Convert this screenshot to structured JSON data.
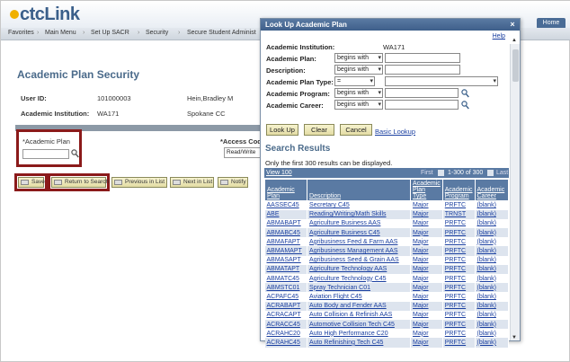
{
  "app": {
    "logo_text": "ctcLink",
    "home_label": "Home"
  },
  "nav": {
    "items": [
      "Favorites",
      "Main Menu",
      "Set Up SACR",
      "Security",
      "Secure Student Administ"
    ],
    "separator": "›"
  },
  "page": {
    "title": "Academic Plan Security",
    "user_id_label": "User ID:",
    "user_id_value": "101000003",
    "user_name": "Hein,Bradley M",
    "institution_label": "Academic Institution:",
    "institution_value": "WA171",
    "institution_name": "Spokane CC",
    "academic_plan_label": "*Academic Plan",
    "access_code_label": "*Access Cod",
    "access_code_value": "Read/Write"
  },
  "toolbar": {
    "save_label": "Save",
    "return_label": "Return to Search",
    "prev_label": "Previous in List",
    "next_label": "Next in List",
    "notify_label": "Notify"
  },
  "modal": {
    "title": "Look Up Academic Plan",
    "close_glyph": "×",
    "help_label": "Help",
    "institution_label": "Academic Institution:",
    "institution_value": "WA171",
    "plan_label": "Academic Plan:",
    "plan_operator": "begins with",
    "description_label": "Description:",
    "description_operator": "begins with",
    "plan_type_label": "Academic Plan Type:",
    "plan_type_operator": "=",
    "program_label": "Academic Program:",
    "program_operator": "begins with",
    "career_label": "Academic Career:",
    "career_operator": "begins with",
    "lookup_label": "Look Up",
    "clear_label": "Clear",
    "cancel_label": "Cancel",
    "basic_lookup_label": "Basic Lookup",
    "results_title": "Search Results",
    "results_note": "Only the first 300 results can be displayed.",
    "view_label": "View 100",
    "first_label": "First",
    "range_label": "1-300 of 300",
    "last_label": "Last",
    "columns": [
      "Academic Plan",
      "Description",
      "Academic Plan Type",
      "Academic Program",
      "Academic Career"
    ],
    "rows": [
      [
        "AASSEC45",
        "Secretary C45",
        "Major",
        "PRFTC",
        "(blank)"
      ],
      [
        "ABE",
        "Reading/Writing/Math Skills",
        "Major",
        "TRNST",
        "(blank)"
      ],
      [
        "ABMABAPT",
        "Agriculture Business AAS",
        "Major",
        "PRFTC",
        "(blank)"
      ],
      [
        "ABMABC45",
        "Agriculture Business C45",
        "Major",
        "PRFTC",
        "(blank)"
      ],
      [
        "ABMAFAPT",
        "Agribusiness Feed & Farm AAS",
        "Major",
        "PRFTC",
        "(blank)"
      ],
      [
        "ABMAMAPT",
        "Agribusiness Management AAS",
        "Major",
        "PRFTC",
        "(blank)"
      ],
      [
        "ABMASAPT",
        "Agribusiness Seed & Grain AAS",
        "Major",
        "PRFTC",
        "(blank)"
      ],
      [
        "ABMATAPT",
        "Agriculture Technology AAS",
        "Major",
        "PRFTC",
        "(blank)"
      ],
      [
        "ABMATC45",
        "Agriculture Technology C45",
        "Major",
        "PRFTC",
        "(blank)"
      ],
      [
        "ABMSTC01",
        "Spray Technician C01",
        "Major",
        "PRFTC",
        "(blank)"
      ],
      [
        "ACPAFC45",
        "Aviation Flight C45",
        "Major",
        "PRFTC",
        "(blank)"
      ],
      [
        "ACRABAPT",
        "Auto Body and Fender AAS",
        "Major",
        "PRFTC",
        "(blank)"
      ],
      [
        "ACRACAPT",
        "Auto Collision & Refinish AAS",
        "Major",
        "PRFTC",
        "(blank)"
      ],
      [
        "ACRACC45",
        "Automotive Collision Tech C45",
        "Major",
        "PRFTC",
        "(blank)"
      ],
      [
        "ACRAHC20",
        "Auto High Performance C20",
        "Major",
        "PRFTC",
        "(blank)"
      ],
      [
        "ACRAHC45",
        "Auto Refinishing Tech C45",
        "Major",
        "PRFTC",
        "(blank)"
      ]
    ]
  }
}
